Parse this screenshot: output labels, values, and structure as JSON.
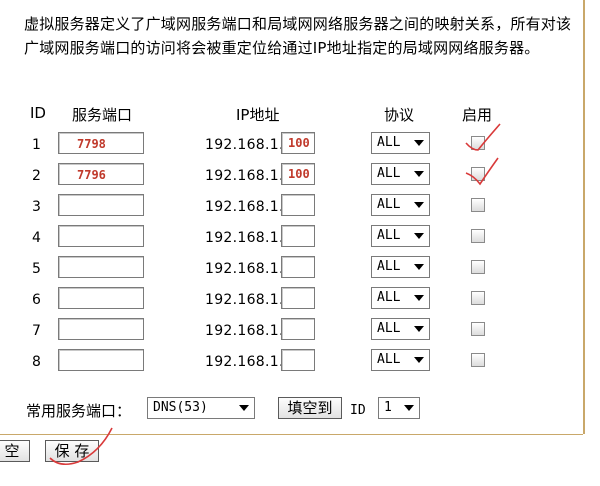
{
  "description": "虚拟服务器定义了广域网服务端口和局域网网络服务器之间的映射关系，所有对该广域网服务端口的访问将会被重定位给通过IP地址指定的局域网网络服务器。",
  "headers": {
    "id": "ID",
    "port": "服务端口",
    "ip": "IP地址",
    "protocol": "协议",
    "enable": "启用"
  },
  "ip_prefix": "192.168.1.",
  "rows": [
    {
      "id": "1",
      "port": "7798",
      "ip_last": "100",
      "protocol": "ALL"
    },
    {
      "id": "2",
      "port": "7796",
      "ip_last": "100",
      "protocol": "ALL"
    },
    {
      "id": "3",
      "port": "",
      "ip_last": "",
      "protocol": "ALL"
    },
    {
      "id": "4",
      "port": "",
      "ip_last": "",
      "protocol": "ALL"
    },
    {
      "id": "5",
      "port": "",
      "ip_last": "",
      "protocol": "ALL"
    },
    {
      "id": "6",
      "port": "",
      "ip_last": "",
      "protocol": "ALL"
    },
    {
      "id": "7",
      "port": "",
      "ip_last": "",
      "protocol": "ALL"
    },
    {
      "id": "8",
      "port": "",
      "ip_last": "",
      "protocol": "ALL"
    }
  ],
  "common_ports": {
    "label": "常用服务端口：",
    "selected": "DNS(53)",
    "fill_button": "填空到",
    "id_label": "ID",
    "id_selected": "1"
  },
  "footer": {
    "clear_button": "空",
    "save_button": "保 存"
  },
  "colors": {
    "value_text": "#c0392b",
    "annotation": "#d93a3a",
    "border_accent": "#c9a86a"
  }
}
